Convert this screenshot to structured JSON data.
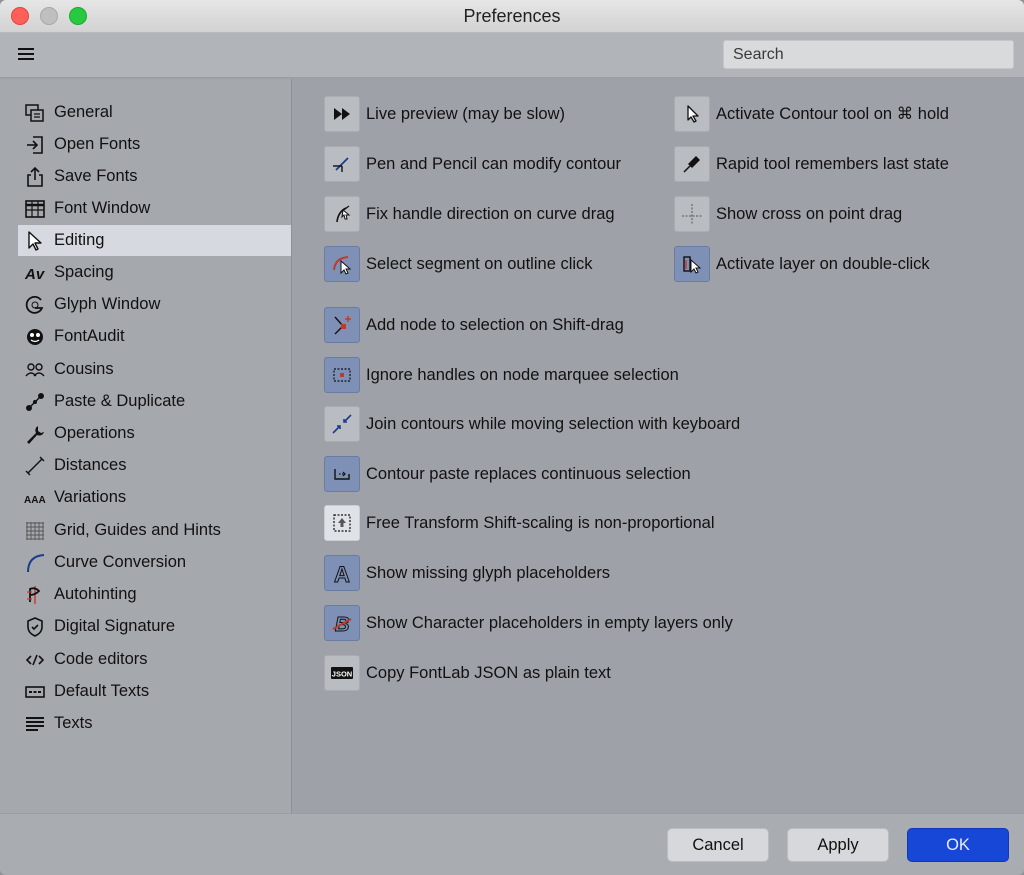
{
  "window": {
    "title": "Preferences"
  },
  "toolbar": {
    "search_placeholder": "Search"
  },
  "sidebar": {
    "items": [
      {
        "label": "General",
        "icon": "general-icon"
      },
      {
        "label": "Open Fonts",
        "icon": "open-fonts-icon"
      },
      {
        "label": "Save Fonts",
        "icon": "save-fonts-icon"
      },
      {
        "label": "Font Window",
        "icon": "font-window-icon"
      },
      {
        "label": "Editing",
        "icon": "cursor-icon",
        "active": true
      },
      {
        "label": "Spacing",
        "icon": "spacing-icon"
      },
      {
        "label": "Glyph Window",
        "icon": "glyph-window-icon"
      },
      {
        "label": "FontAudit",
        "icon": "fontaudit-icon"
      },
      {
        "label": "Cousins",
        "icon": "cousins-icon"
      },
      {
        "label": "Paste & Duplicate",
        "icon": "paste-duplicate-icon"
      },
      {
        "label": "Operations",
        "icon": "wrench-icon"
      },
      {
        "label": "Distances",
        "icon": "distances-icon"
      },
      {
        "label": "Variations",
        "icon": "variations-icon"
      },
      {
        "label": "Grid, Guides and Hints",
        "icon": "grid-icon"
      },
      {
        "label": "Curve Conversion",
        "icon": "curve-icon"
      },
      {
        "label": "Autohinting",
        "icon": "autohinting-icon"
      },
      {
        "label": "Digital Signature",
        "icon": "shield-icon"
      },
      {
        "label": "Code editors",
        "icon": "code-icon"
      },
      {
        "label": "Default Texts",
        "icon": "default-texts-icon"
      },
      {
        "label": "Texts",
        "icon": "texts-icon"
      }
    ]
  },
  "options": {
    "col1": [
      {
        "label": "Live preview (may be slow)",
        "icon": "fast-forward-icon",
        "enabled": false
      },
      {
        "label": "Pen and Pencil can modify contour",
        "icon": "pen-contour-icon",
        "enabled": false
      },
      {
        "label": "Fix handle direction on curve drag",
        "icon": "handle-direction-icon",
        "enabled": false
      },
      {
        "label": "Select segment on outline click",
        "icon": "select-segment-icon",
        "enabled": true
      }
    ],
    "col2": [
      {
        "label": "Activate Contour tool on ⌘ hold",
        "icon": "arrow-cursor-icon",
        "enabled": false
      },
      {
        "label": "Rapid tool remembers last state",
        "icon": "rapid-tool-icon",
        "enabled": false
      },
      {
        "label": "Show cross on point drag",
        "icon": "crosshair-icon",
        "enabled": false
      },
      {
        "label": "Activate layer on double-click",
        "icon": "layer-click-icon",
        "enabled": true
      }
    ],
    "list": [
      {
        "label": "Add node to selection on Shift-drag",
        "icon": "add-node-icon",
        "enabled": true
      },
      {
        "label": "Ignore handles on node marquee selection",
        "icon": "marquee-icon",
        "enabled": true
      },
      {
        "label": "Join contours while moving selection with keyboard",
        "icon": "join-contours-icon",
        "enabled": false
      },
      {
        "label": "Contour paste replaces continuous selection",
        "icon": "contour-paste-icon",
        "enabled": true
      },
      {
        "label": "Free Transform Shift-scaling is non-proportional",
        "icon": "free-transform-icon",
        "enabled": false,
        "highlighted": true
      },
      {
        "label": "Show missing glyph placeholders",
        "icon": "glyph-placeholder-icon",
        "enabled": true
      },
      {
        "label": "Show Character placeholders in empty layers only",
        "icon": "character-placeholder-icon",
        "enabled": true
      },
      {
        "label": "Copy FontLab JSON as plain text",
        "icon": "json-icon",
        "icon_text": "JSON",
        "enabled": false
      }
    ]
  },
  "footer": {
    "cancel_label": "Cancel",
    "apply_label": "Apply",
    "ok_label": "OK"
  }
}
